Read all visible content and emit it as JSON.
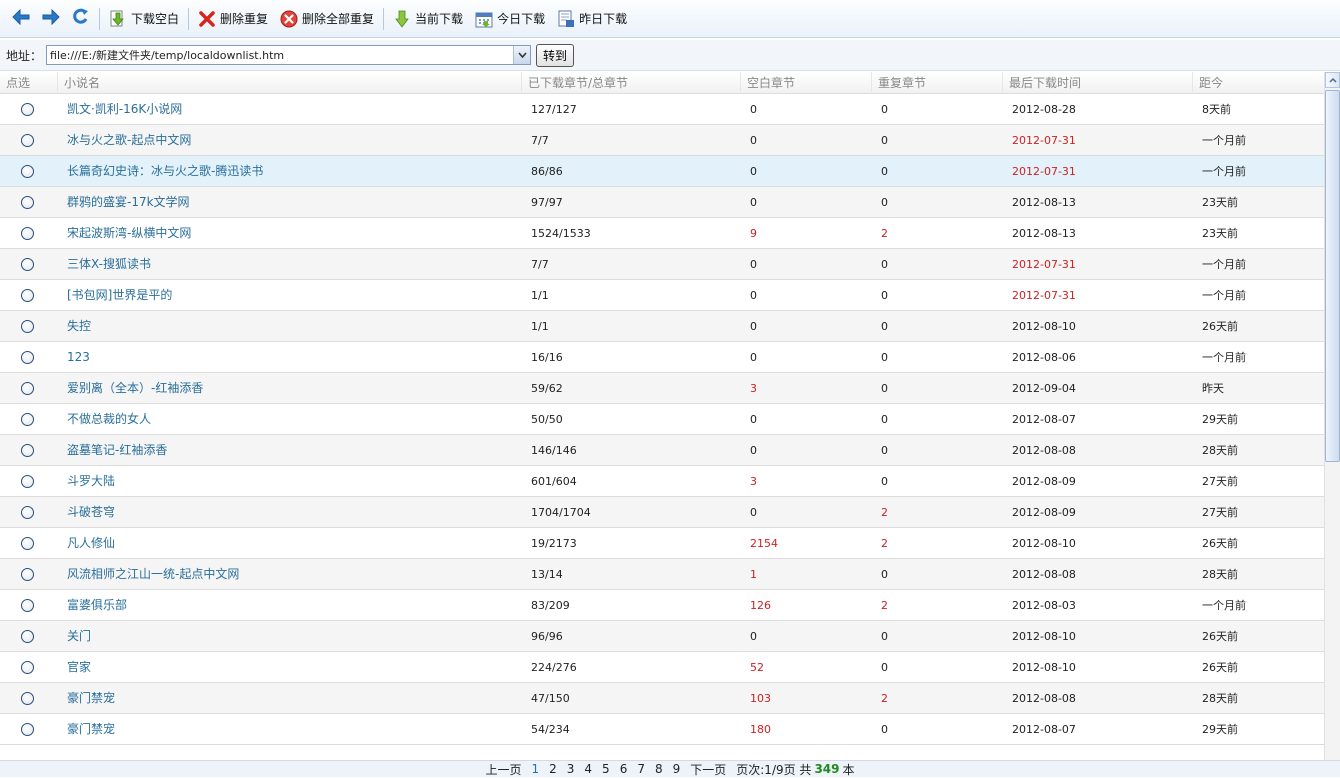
{
  "toolbar": {
    "back_icon": "back-arrow-icon",
    "forward_icon": "forward-arrow-icon",
    "refresh_icon": "refresh-icon",
    "buttons": [
      {
        "label": "下载空白",
        "icon": "download-icon"
      },
      {
        "label": "删除重复",
        "icon": "red-x-icon"
      },
      {
        "label": "删除全部重复",
        "icon": "red-circle-x-icon"
      },
      {
        "label": "当前下载",
        "icon": "download-icon"
      },
      {
        "label": "今日下载",
        "icon": "calendar-icon"
      },
      {
        "label": "昨日下载",
        "icon": "document-icon"
      }
    ]
  },
  "address": {
    "label": "地址：",
    "value": "file:///E:/新建文件夹/temp/localdownlist.htm",
    "go_label": "转到"
  },
  "table": {
    "columns": [
      "点选",
      "小说名",
      "已下载章节/总章节",
      "空白章节",
      "重复章节",
      "最后下载时间",
      "距今"
    ],
    "rows": [
      {
        "title": "凯文·凯利-16K小说网",
        "downloaded": "127/127",
        "blank": "0",
        "dup": "0",
        "last": "2012-08-28",
        "ago": "8天前"
      },
      {
        "title": "冰与火之歌-起点中文网",
        "downloaded": "7/7",
        "blank": "0",
        "dup": "0",
        "last": "2012-07-31",
        "ago": "一个月前"
      },
      {
        "title": "长篇奇幻史诗：冰与火之歌-腾迅读书",
        "downloaded": "86/86",
        "blank": "0",
        "dup": "0",
        "last": "2012-07-31",
        "ago": "一个月前"
      },
      {
        "title": "群鸦的盛宴-17k文学网",
        "downloaded": "97/97",
        "blank": "0",
        "dup": "0",
        "last": "2012-08-13",
        "ago": "23天前"
      },
      {
        "title": "宋起波斯湾-纵横中文网",
        "downloaded": "1524/1533",
        "blank": "9",
        "dup": "2",
        "last": "2012-08-13",
        "ago": "23天前"
      },
      {
        "title": "三体X-搜狐读书",
        "downloaded": "7/7",
        "blank": "0",
        "dup": "0",
        "last": "2012-07-31",
        "ago": "一个月前"
      },
      {
        "title": "[书包网]世界是平的",
        "downloaded": "1/1",
        "blank": "0",
        "dup": "0",
        "last": "2012-07-31",
        "ago": "一个月前"
      },
      {
        "title": "失控",
        "downloaded": "1/1",
        "blank": "0",
        "dup": "0",
        "last": "2012-08-10",
        "ago": "26天前"
      },
      {
        "title": "123",
        "downloaded": "16/16",
        "blank": "0",
        "dup": "0",
        "last": "2012-08-06",
        "ago": "一个月前"
      },
      {
        "title": "爱别离（全本）-红袖添香",
        "downloaded": "59/62",
        "blank": "3",
        "dup": "0",
        "last": "2012-09-04",
        "ago": "昨天"
      },
      {
        "title": "不做总裁的女人",
        "downloaded": "50/50",
        "blank": "0",
        "dup": "0",
        "last": "2012-08-07",
        "ago": "29天前"
      },
      {
        "title": "盗墓笔记-红袖添香",
        "downloaded": "146/146",
        "blank": "0",
        "dup": "0",
        "last": "2012-08-08",
        "ago": "28天前"
      },
      {
        "title": "斗罗大陆",
        "downloaded": "601/604",
        "blank": "3",
        "dup": "0",
        "last": "2012-08-09",
        "ago": "27天前"
      },
      {
        "title": "斗破苍穹",
        "downloaded": "1704/1704",
        "blank": "0",
        "dup": "2",
        "last": "2012-08-09",
        "ago": "27天前"
      },
      {
        "title": "凡人修仙",
        "downloaded": "19/2173",
        "blank": "2154",
        "dup": "2",
        "last": "2012-08-10",
        "ago": "26天前"
      },
      {
        "title": "风流相师之江山一统-起点中文网",
        "downloaded": "13/14",
        "blank": "1",
        "dup": "0",
        "last": "2012-08-08",
        "ago": "28天前"
      },
      {
        "title": "富婆俱乐部",
        "downloaded": "83/209",
        "blank": "126",
        "dup": "2",
        "last": "2012-08-03",
        "ago": "一个月前"
      },
      {
        "title": "关门",
        "downloaded": "96/96",
        "blank": "0",
        "dup": "0",
        "last": "2012-08-10",
        "ago": "26天前"
      },
      {
        "title": "官家",
        "downloaded": "224/276",
        "blank": "52",
        "dup": "0",
        "last": "2012-08-10",
        "ago": "26天前"
      },
      {
        "title": "豪门禁宠",
        "downloaded": "47/150",
        "blank": "103",
        "dup": "2",
        "last": "2012-08-08",
        "ago": "28天前"
      },
      {
        "title": "豪门禁宠",
        "downloaded": "54/234",
        "blank": "180",
        "dup": "0",
        "last": "2012-08-07",
        "ago": "29天前"
      }
    ]
  },
  "pager": {
    "prev": "上一页",
    "pages": [
      "1",
      "2",
      "3",
      "4",
      "5",
      "6",
      "7",
      "8",
      "9"
    ],
    "active_page": "1",
    "next": "下一页",
    "info_prefix": "页次:1/9页 共",
    "total": "349",
    "unit": "本"
  },
  "colors": {
    "link": "#2a6f9a",
    "alert_red": "#cc2222",
    "selected_row": "#e2f1fa",
    "count_green": "#1f8a1f"
  }
}
